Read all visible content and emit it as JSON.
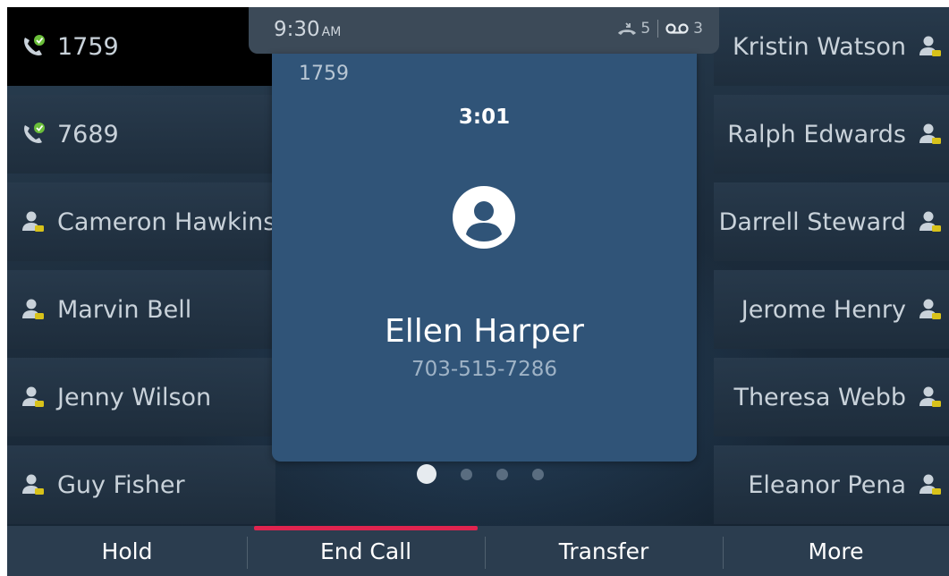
{
  "status_bar": {
    "time": "9:30",
    "ampm": "AM",
    "missed_calls": "5",
    "voicemails": "3"
  },
  "left_keys": [
    {
      "label": "1759",
      "icon": "phone-active-icon",
      "active": true
    },
    {
      "label": "7689",
      "icon": "phone-active-icon",
      "active": false
    },
    {
      "label": "Cameron Hawkins",
      "icon": "contact-icon",
      "active": false
    },
    {
      "label": "Marvin Bell",
      "icon": "contact-icon",
      "active": false
    },
    {
      "label": "Jenny Wilson",
      "icon": "contact-icon",
      "active": false
    },
    {
      "label": "Guy  Fisher",
      "icon": "contact-icon",
      "active": false
    }
  ],
  "right_keys": [
    {
      "label": "Kristin Watson",
      "icon": "contact-icon"
    },
    {
      "label": "Ralph Edwards",
      "icon": "contact-icon"
    },
    {
      "label": "Darrell Steward",
      "icon": "contact-icon"
    },
    {
      "label": "Jerome Henry",
      "icon": "contact-icon"
    },
    {
      "label": "Theresa Webb",
      "icon": "contact-icon"
    },
    {
      "label": "Eleanor Pena",
      "icon": "contact-icon"
    }
  ],
  "call": {
    "line": "1759",
    "duration": "3:01",
    "caller_name": "Ellen Harper",
    "caller_number": "703-515-7286",
    "avatar_icon": "person-avatar-icon"
  },
  "pagination": {
    "pages": 4,
    "current": 1
  },
  "softkeys": [
    {
      "label": "Hold"
    },
    {
      "label": "End Call",
      "selected": true
    },
    {
      "label": "Transfer"
    },
    {
      "label": "More"
    }
  ],
  "colors": {
    "accent": "#e0244f",
    "card": "#305478",
    "presence_available": "#6bbf3a",
    "presence_away": "#d8c21a"
  }
}
